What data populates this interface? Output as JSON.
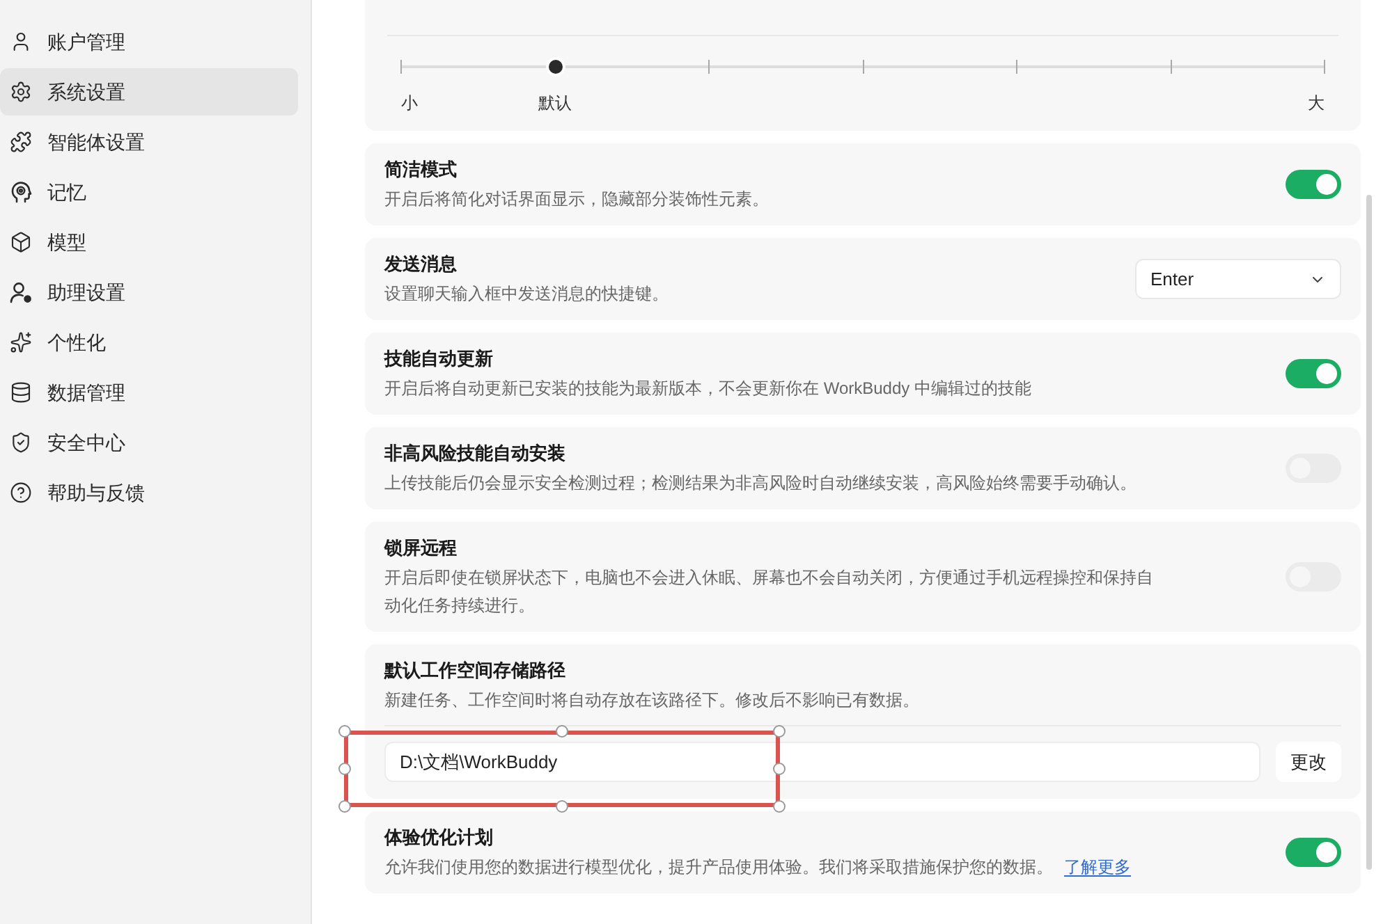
{
  "sidebar": {
    "items": [
      {
        "label": "账户管理",
        "selected": false
      },
      {
        "label": "系统设置",
        "selected": true
      },
      {
        "label": "智能体设置",
        "selected": false
      },
      {
        "label": "记忆",
        "selected": false
      },
      {
        "label": "模型",
        "selected": false
      },
      {
        "label": "助理设置",
        "selected": false
      },
      {
        "label": "个性化",
        "selected": false
      },
      {
        "label": "数据管理",
        "selected": false
      },
      {
        "label": "安全中心",
        "selected": false
      },
      {
        "label": "帮助与反馈",
        "selected": false
      }
    ]
  },
  "font_size_slider": {
    "level": 0.1667,
    "labels": [
      "小",
      "默认",
      "大"
    ]
  },
  "settings": [
    {
      "kind": "toggle",
      "title": "简洁模式",
      "description": "开启后将简化对话界面显示，隐藏部分装饰性元素。",
      "on": true
    },
    {
      "kind": "select",
      "title": "发送消息",
      "description": "设置聊天输入框中发送消息的快捷键。",
      "value": "Enter"
    },
    {
      "kind": "toggle",
      "title": "技能自动更新",
      "description": "开启后将自动更新已安装的技能为最新版本，不会更新你在 WorkBuddy 中编辑过的技能",
      "on": true
    },
    {
      "kind": "toggle",
      "title": "非高风险技能自动安装",
      "description": "上传技能后仍会显示安全检测过程；检测结果为非高风险时自动继续安装，高风险始终需要手动确认。",
      "on": false
    },
    {
      "kind": "toggle",
      "title": "锁屏远程",
      "description": "开启后即使在锁屏状态下，电脑也不会进入休眠、屏幕也不会自动关闭，方便通过手机远程操控和保持自动化任务持续进行。",
      "on": false
    },
    {
      "kind": "path",
      "title": "默认工作空间存储路径",
      "description": "新建任务、工作空间时将自动存放在该路径下。修改后不影响已有数据。",
      "value": "D:\\文档\\WorkBuddy",
      "button": "更改"
    },
    {
      "kind": "toggle",
      "title": "体验优化计划",
      "description": "允许我们使用您的数据进行模型优化，提升产品使用体验。我们将采取措施保护您的数据。",
      "link": "了解更多",
      "on": true
    }
  ]
}
